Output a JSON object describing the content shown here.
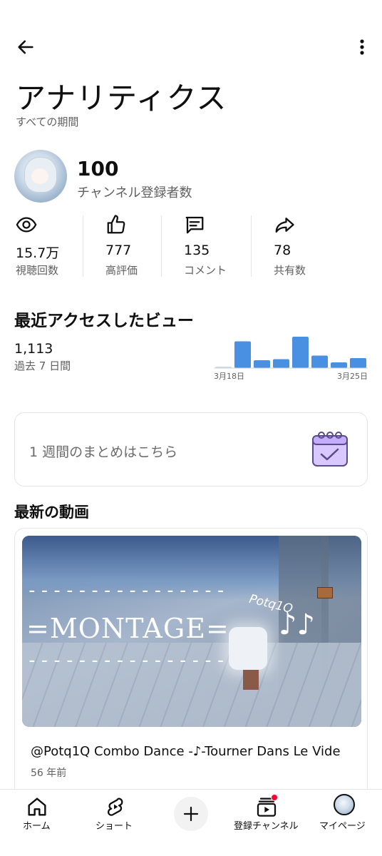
{
  "header": {
    "title": "アナリティクス",
    "subtitle": "すべての期間"
  },
  "channel": {
    "subscribers": "100",
    "subscribers_label": "チャンネル登録者数"
  },
  "stats": [
    {
      "icon": "eye-icon",
      "value": "15.7万",
      "label": "視聴回数"
    },
    {
      "icon": "thumbs-up-icon",
      "value": "777",
      "label": "高評価"
    },
    {
      "icon": "comment-icon",
      "value": "135",
      "label": "コメント"
    },
    {
      "icon": "share-icon",
      "value": "78",
      "label": "共有数"
    }
  ],
  "recent": {
    "title": "最近アクセスしたビュー",
    "count": "1,113",
    "period": "過去 7 日間",
    "chart_data": {
      "type": "bar",
      "values": [
        2,
        75,
        22,
        25,
        88,
        35,
        16,
        28
      ],
      "x_start_label": "3月18日",
      "x_end_label": "3月25日",
      "color": "#4a90e2"
    }
  },
  "weekly": {
    "text": "1 週間のまとめはこちら"
  },
  "latest": {
    "title": "最新の動画",
    "thumbnail": {
      "dashes_top": "----------------",
      "montage": "=MONTAGE=",
      "dashes_bottom": "----------------",
      "tag": "Potq1Q",
      "notes": "♪♪"
    },
    "video_title": "@Potq1Q Combo Dance ‐♪-Tourner Dans Le Vide",
    "video_age": "56 年前"
  },
  "nav": {
    "home": "ホーム",
    "shorts": "ショート",
    "subscriptions": "登録チャンネル",
    "you": "マイページ"
  }
}
